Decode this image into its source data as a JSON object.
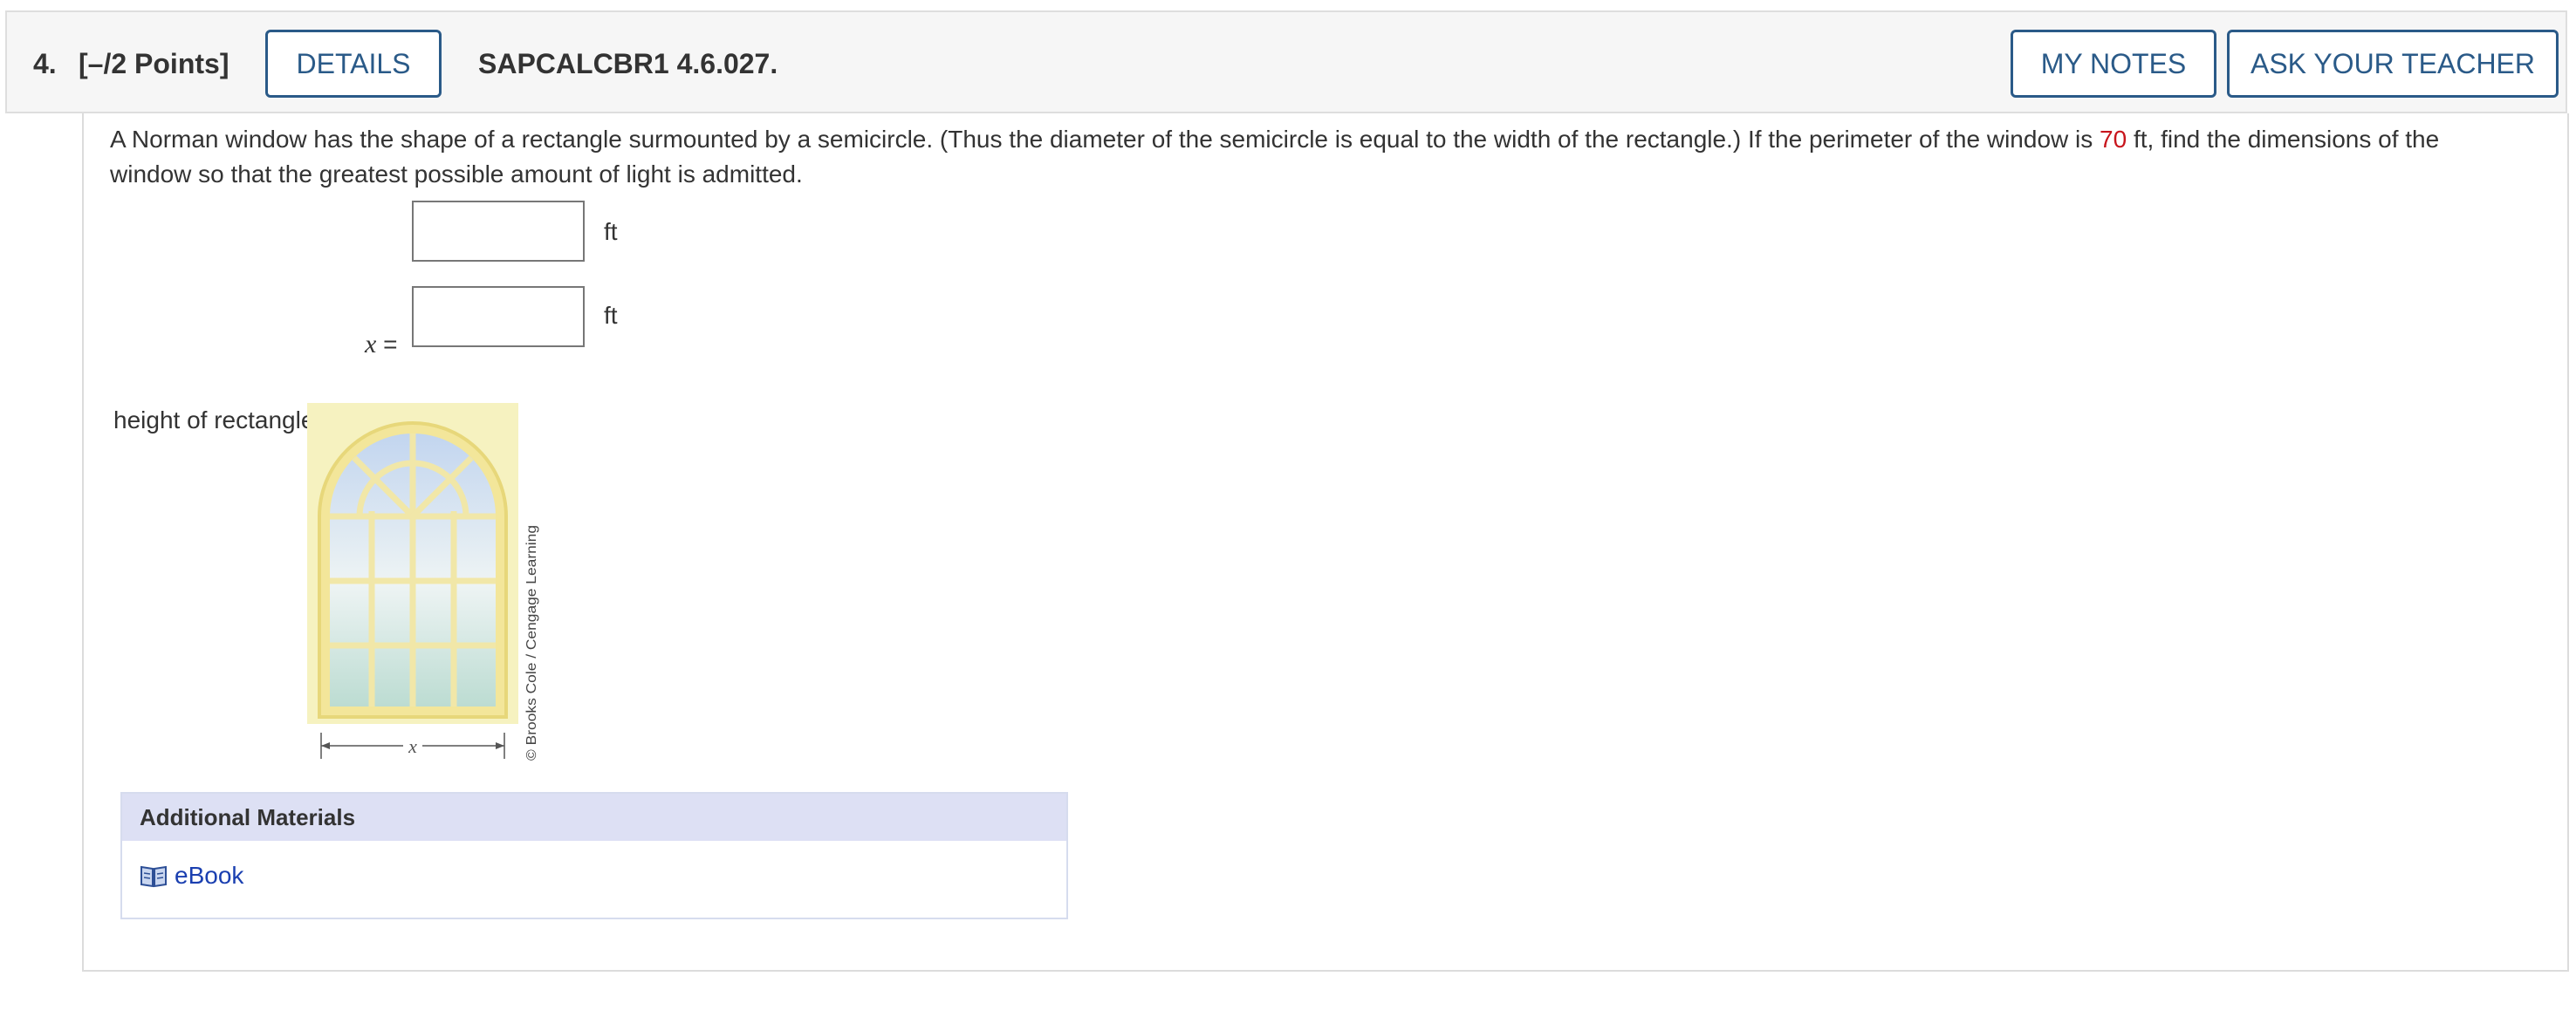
{
  "header": {
    "number": "4.",
    "points": "[–/2 Points]",
    "details_label": "DETAILS",
    "code": "SAPCALCBR1 4.6.027.",
    "my_notes_label": "MY NOTES",
    "ask_teacher_label": "ASK YOUR TEACHER"
  },
  "problem": {
    "text_before": "A Norman window has the shape of a rectangle surmounted by a semicircle. (Thus the diameter of the semicircle is equal to the width of the rectangle.) If the perimeter of the window is ",
    "perimeter_value": "70",
    "text_after": " ft, find the dimensions of the window so that the greatest possible amount of light is admitted."
  },
  "answers": {
    "x_label_var": "x",
    "x_label_eq": " =",
    "x_value": "",
    "x_unit": "ft",
    "height_label": "height of rectangle",
    "height_value": "",
    "height_unit": "ft"
  },
  "figure": {
    "dimension_label": "x",
    "credit": "© Brooks Cole / Cengage Learning"
  },
  "materials": {
    "title": "Additional Materials",
    "ebook_label": "eBook",
    "ebook_icon": "book-icon"
  },
  "colors": {
    "accent": "#2a5a88",
    "highlight": "#c8161d",
    "link": "#1a3fb0",
    "materials_header": "#dde0f4"
  }
}
